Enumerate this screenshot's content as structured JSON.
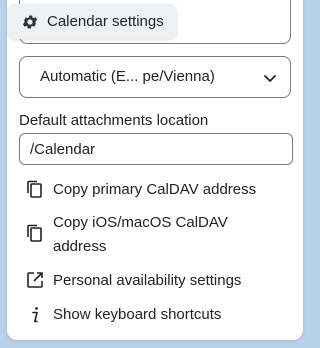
{
  "header": {
    "title": "Calendar settings",
    "icon": "gear-icon"
  },
  "timezone_select": {
    "value": "Automatic (E...  pe/Vienna)"
  },
  "attachments": {
    "label": "Default attachments location",
    "value": "/Calendar"
  },
  "menu": [
    {
      "label": "Copy primary CalDAV address",
      "icon": "copy-icon"
    },
    {
      "label": "Copy iOS/macOS CalDAV address",
      "icon": "copy-icon"
    },
    {
      "label": "Personal availability settings",
      "icon": "external-link-icon"
    },
    {
      "label": "Show keyboard shortcuts",
      "icon": "info-icon"
    }
  ],
  "colors": {
    "background": "#b9d2ec",
    "panel": "#ffffff",
    "border": "#7a7a7a"
  }
}
